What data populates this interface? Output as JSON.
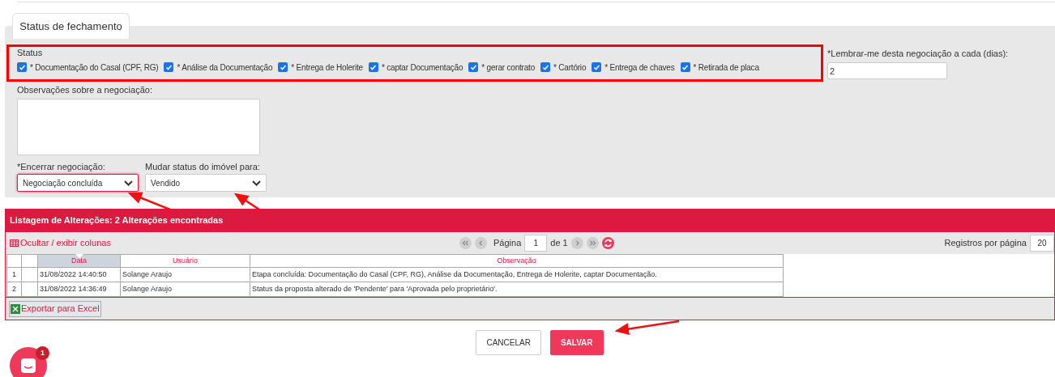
{
  "tab": {
    "label": "Status de fechamento",
    "selected": true
  },
  "status": {
    "label": "Status",
    "items": [
      {
        "label": "* Documentação do Casal (CPF, RG)",
        "checked": true
      },
      {
        "label": "* Análise da Documentação",
        "checked": true
      },
      {
        "label": "* Entrega de Holerite",
        "checked": true
      },
      {
        "label": "* captar Documentação",
        "checked": true
      },
      {
        "label": "* gerar contrato",
        "checked": true
      },
      {
        "label": "* Cartório",
        "checked": true
      },
      {
        "label": "* Entrega de chaves",
        "checked": true
      },
      {
        "label": "* Retirada de placa",
        "checked": true
      }
    ]
  },
  "reminder": {
    "label": "*Lembrar-me desta negociação a cada (dias):",
    "value": "2"
  },
  "notes": {
    "label": "Observações sobre a negociação:"
  },
  "close_select": {
    "label": "*Encerrar negociação:",
    "value": "Negociação concluída"
  },
  "property_status_select": {
    "label": "Mudar status do imóvel para:",
    "value": "Vendido"
  },
  "changes": {
    "title": "Listagem de Alterações: 2 Alterações encontradas",
    "columns_link": "Ocultar / exibir colunas",
    "pager": {
      "page_label": "Página",
      "page": "1",
      "of": "de 1",
      "per_page_label": "Registros por página",
      "per_page": "20"
    },
    "columns": [
      {
        "sorted": false
      },
      {
        "sorted": false
      },
      {
        "label": "Data",
        "sorted": true
      },
      {
        "label": "Usuário",
        "sorted": false
      },
      {
        "label": "Observação",
        "sorted": false
      }
    ],
    "rows": [
      [
        "1",
        "",
        "31/08/2022 14:40:50",
        "Solange Araujo",
        "Etapa concluída: Documentação do Casal (CPF, RG), Análise da Documentação, Entrega de Holerite, captar Documentação."
      ],
      [
        "2",
        "",
        "31/08/2022 14:36:49",
        "Solange Araujo",
        "Status da proposta alterado de 'Pendente' para 'Aprovada pelo proprietário'."
      ]
    ],
    "export": "Exportar para Excel"
  },
  "buttons": [
    {
      "label": "CANCELAR",
      "kind": "secondary"
    },
    {
      "label": "SALVAR",
      "kind": "primary"
    }
  ],
  "chat": {
    "badge": "1"
  }
}
